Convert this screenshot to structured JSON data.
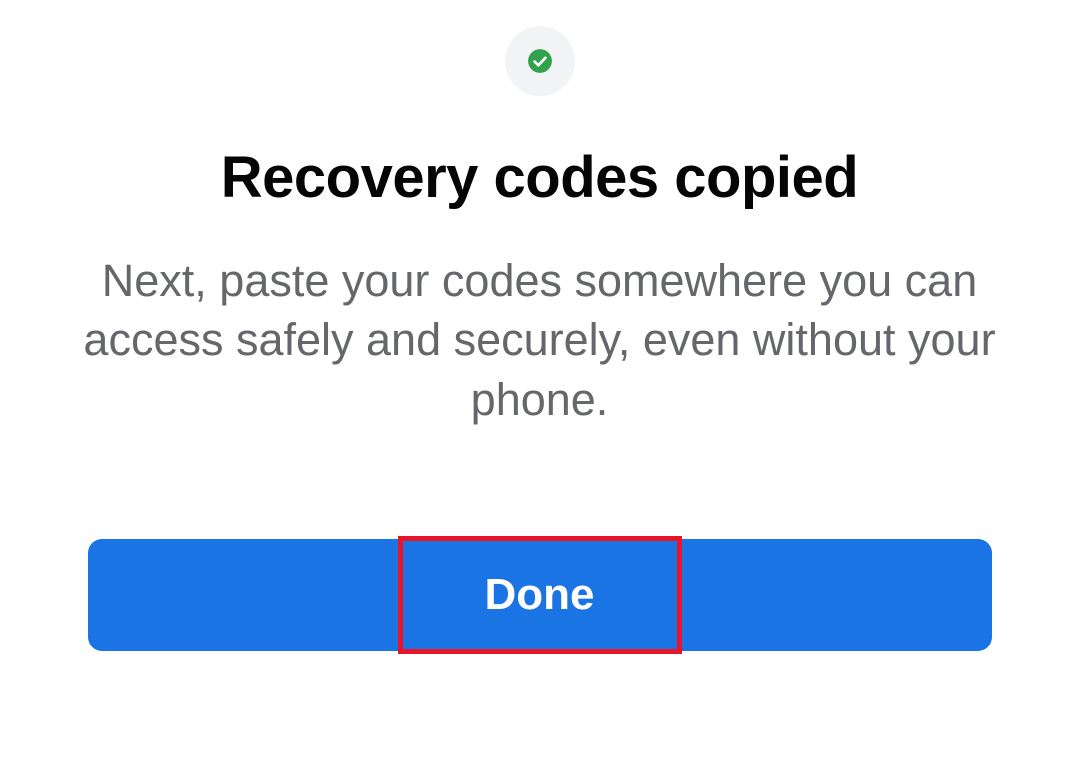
{
  "dialog": {
    "icon_name": "checkmark-icon",
    "heading": "Recovery codes copied",
    "description": "Next, paste your codes somewhere you can access safely and securely, even without your phone.",
    "done_label": "Done"
  },
  "colors": {
    "primary": "#1b74e4",
    "text_primary": "#050505",
    "text_secondary": "#65676b",
    "icon_bg": "#f2f3f5",
    "icon_color": "#31a24c",
    "highlight": "#e8152a"
  }
}
